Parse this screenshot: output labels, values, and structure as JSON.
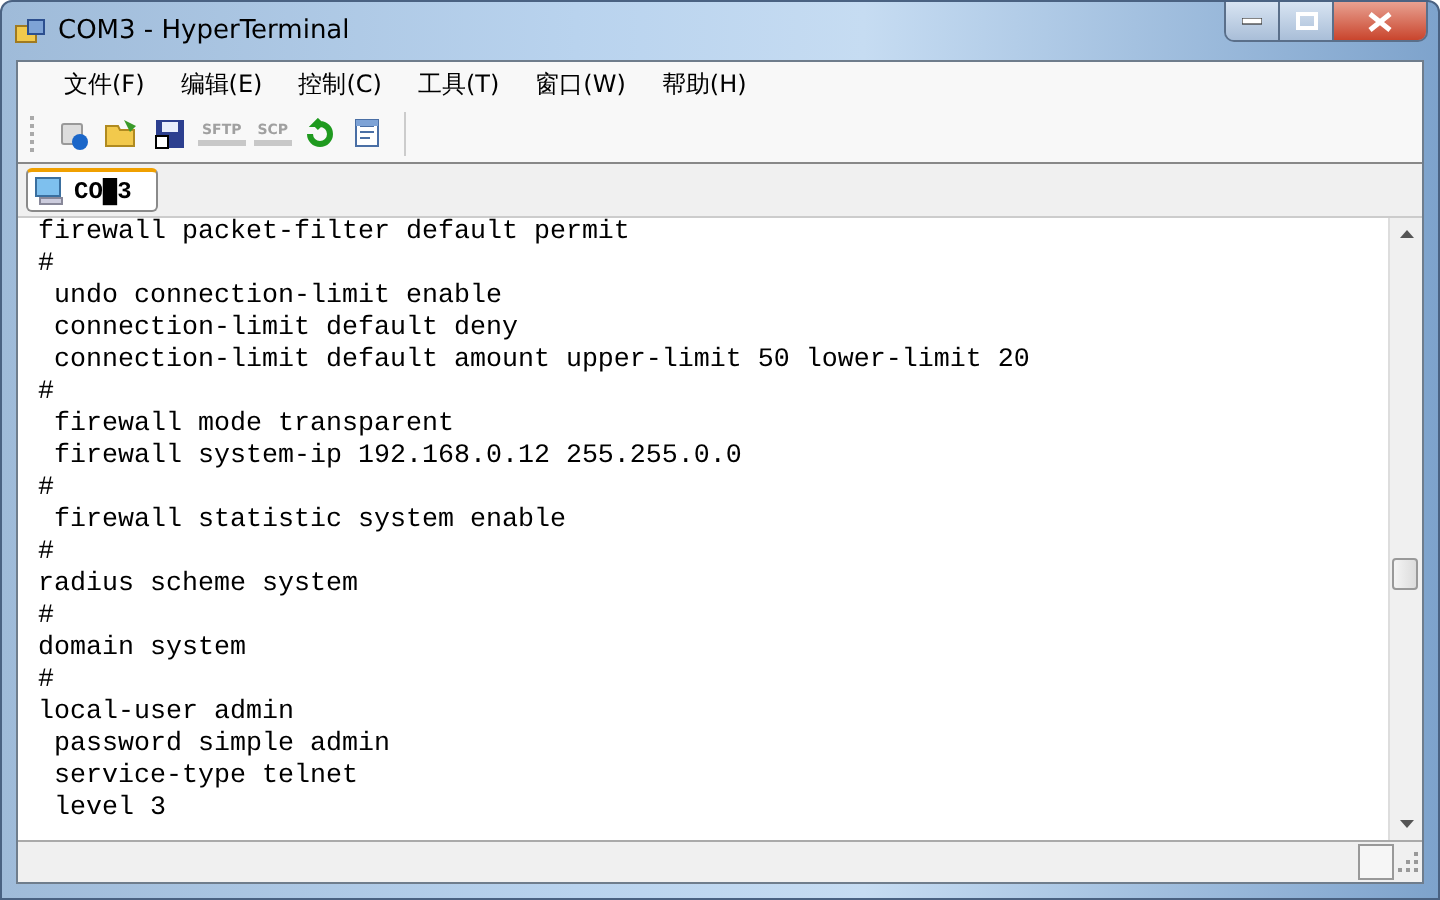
{
  "window": {
    "title": "COM3 - HyperTerminal"
  },
  "menu": [
    "文件(F)",
    "编辑(E)",
    "控制(C)",
    "工具(T)",
    "窗口(W)",
    "帮助(H)"
  ],
  "toolbar": [
    {
      "kind": "connect"
    },
    {
      "kind": "open"
    },
    {
      "kind": "save"
    },
    {
      "kind": "label",
      "text": "SFTP",
      "disabled": true
    },
    {
      "kind": "label",
      "text": "SCP",
      "disabled": true
    },
    {
      "kind": "reconnect"
    },
    {
      "kind": "properties"
    }
  ],
  "tabs": [
    {
      "label": "CO█3",
      "selected": true
    }
  ],
  "terminal": {
    "lines": [
      "firewall packet-filter default permit",
      "#",
      " undo connection-limit enable",
      " connection-limit default deny",
      " connection-limit default amount upper-limit 50 lower-limit 20",
      "#",
      " firewall mode transparent",
      " firewall system-ip 192.168.0.12 255.255.0.0",
      "#",
      " firewall statistic system enable",
      "#",
      "radius scheme system",
      "#",
      "domain system",
      "#",
      "local-user admin",
      " password simple admin",
      " service-type telnet",
      " level 3"
    ]
  }
}
